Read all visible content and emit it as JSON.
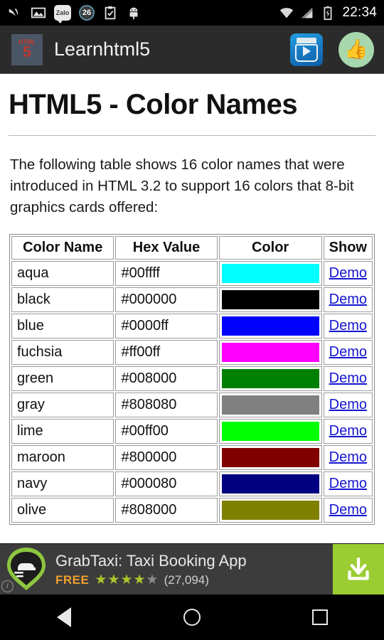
{
  "status_bar": {
    "icons": [
      "swallow-icon",
      "gallery-icon",
      "zalo-icon",
      "notification-count-icon",
      "clipboard-check-icon",
      "android-icon"
    ],
    "zalo_label": "Zalo",
    "notification_count": "26",
    "right_icons": [
      "wifi-icon",
      "cellular-signal-icon",
      "battery-charging-icon"
    ],
    "clock": "22:34"
  },
  "app_bar": {
    "logo_top": "HTML",
    "logo_bottom": "5",
    "title": "Learnhtml5",
    "actions": [
      "play-store-icon",
      "thumbs-up-icon"
    ]
  },
  "page": {
    "title": "HTML5 - Color Names",
    "intro": "The following table shows 16 color names that were introduced in HTML 3.2 to support 16 colors that 8-bit graphics cards offered:"
  },
  "table": {
    "headers": [
      "Color Name",
      "Hex Value",
      "Color",
      "Show"
    ],
    "demo_label": "Demo",
    "rows": [
      {
        "name": "aqua",
        "hex": "#00ffff",
        "swatch": "#00ffff",
        "show": "Demo"
      },
      {
        "name": "black",
        "hex": "#000000",
        "swatch": "#000000",
        "show": "Demo"
      },
      {
        "name": "blue",
        "hex": "#0000ff",
        "swatch": "#0000ff",
        "show": "Demo"
      },
      {
        "name": "fuchsia",
        "hex": "#ff00ff",
        "swatch": "#ff00ff",
        "show": "Demo"
      },
      {
        "name": "green",
        "hex": "#008000",
        "swatch": "#008000",
        "show": "Demo"
      },
      {
        "name": "gray",
        "hex": "#808080",
        "swatch": "#808080",
        "show": "Demo"
      },
      {
        "name": "lime",
        "hex": "#00ff00",
        "swatch": "#00ff00",
        "show": "Demo"
      },
      {
        "name": "maroon",
        "hex": "#800000",
        "swatch": "#800000",
        "show": "Demo"
      },
      {
        "name": "navy",
        "hex": "#000080",
        "swatch": "#000080",
        "show": "Demo"
      },
      {
        "name": "olive",
        "hex": "#808000",
        "swatch": "#808000",
        "show": "Demo"
      }
    ]
  },
  "ad": {
    "title": "GrabTaxi: Taxi Booking App",
    "price": "FREE",
    "rating_filled": 4,
    "rating_total": 5,
    "review_count": "(27,094)",
    "cta_icon": "download-icon",
    "info_badge": "i"
  },
  "nav_bar": {
    "buttons": [
      "back-icon",
      "home-icon",
      "recents-icon"
    ]
  }
}
